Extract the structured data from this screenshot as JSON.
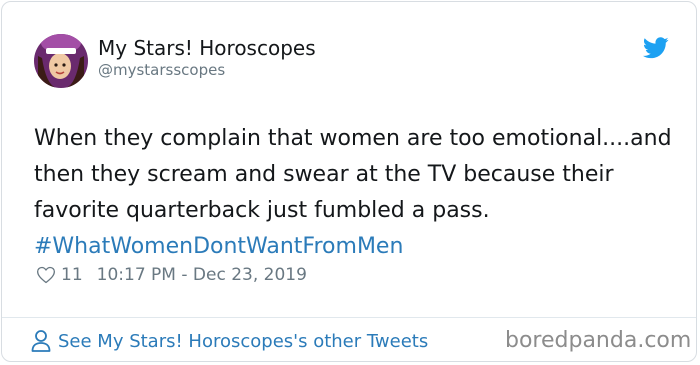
{
  "author": {
    "name": "My Stars! Horoscopes",
    "handle": "@mystarsscopes",
    "avatar": "avatar-illustration"
  },
  "tweet": {
    "text": "When they complain that women are too emotional....and then they scream and swear at the TV because their favorite quarterback just fumbled a pass.",
    "hashtag": "#WhatWomenDontWantFromMen"
  },
  "meta": {
    "like_count": "11",
    "timestamp": "10:17 PM - Dec 23, 2019"
  },
  "footer": {
    "other_tweets_label": "See My Stars! Horoscopes's other Tweets"
  },
  "watermark": "boredpanda.com",
  "icons": {
    "brand": "twitter-bird-icon",
    "like": "heart-icon",
    "profile": "person-icon"
  },
  "colors": {
    "link": "#2b7bb9",
    "twitter_blue": "#1da1f2",
    "text": "#14171a",
    "muted": "#697882"
  }
}
